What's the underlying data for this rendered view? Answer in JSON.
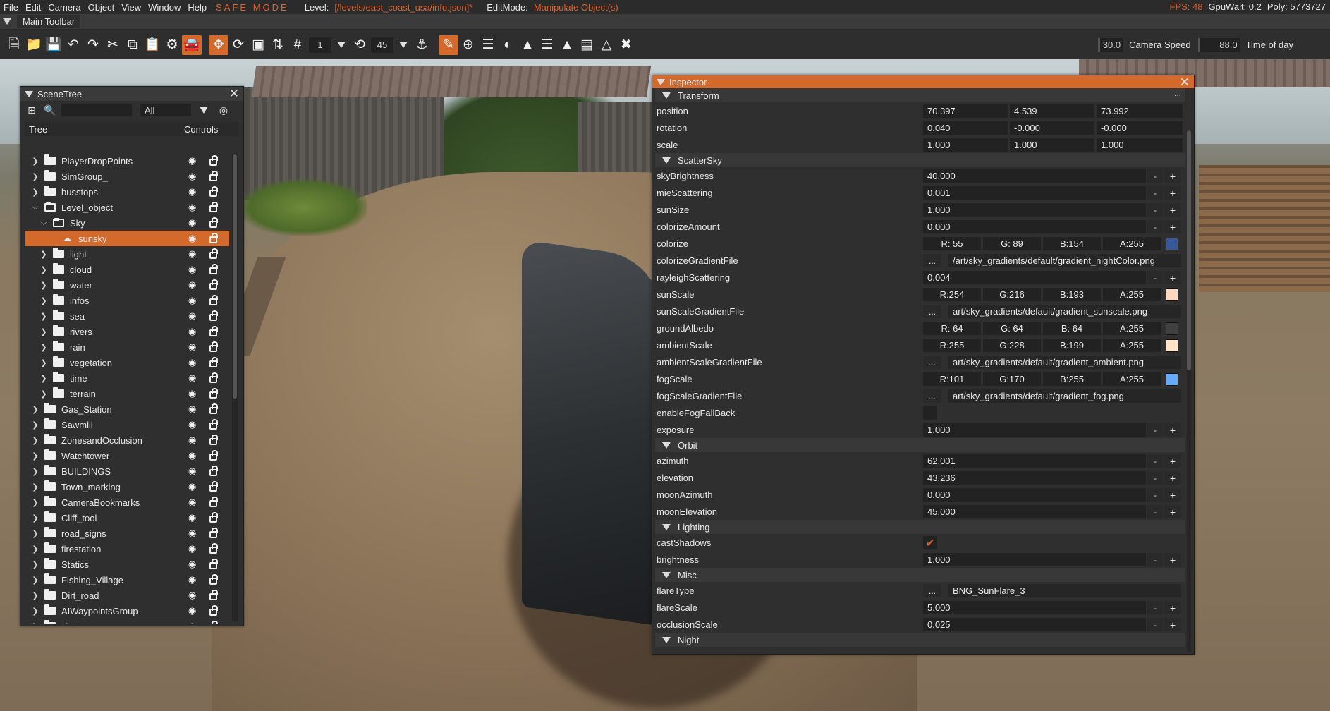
{
  "menubar": {
    "items": [
      "File",
      "Edit",
      "Camera",
      "Object",
      "View",
      "Window",
      "Help"
    ],
    "safe_mode": "SAFE MODE",
    "level_label": "Level:",
    "level_path": "[/levels/east_coast_usa/info.json]*",
    "editmode_label": "EditMode:",
    "editmode_value": "Manipulate Object(s)",
    "fps": "FPS: 48",
    "gpuwait": "GpuWait: 0.2",
    "poly": "Poly: 5773727"
  },
  "toolbar": {
    "title": "Main Toolbar",
    "grid_value": "1",
    "rotate_snap_value": "45",
    "camera_speed_value": "30.0",
    "camera_speed_label": "Camera Speed",
    "time_value": "88.0",
    "time_label": "Time of day"
  },
  "scenetree": {
    "title": "SceneTree",
    "filter": "All",
    "col_tree": "Tree",
    "col_controls": "Controls",
    "rows": [
      {
        "label": "PlayerDropPoints",
        "level": 0,
        "state": "collapsed"
      },
      {
        "label": "SimGroup_",
        "level": 0,
        "state": "collapsed"
      },
      {
        "label": "busstops",
        "level": 0,
        "state": "collapsed"
      },
      {
        "label": "Level_object",
        "level": 0,
        "state": "expanded"
      },
      {
        "label": "Sky",
        "level": 1,
        "state": "expanded"
      },
      {
        "label": "sunsky",
        "level": 2,
        "state": "object",
        "selected": true
      },
      {
        "label": "light",
        "level": 1,
        "state": "collapsed"
      },
      {
        "label": "cloud",
        "level": 1,
        "state": "collapsed"
      },
      {
        "label": "water",
        "level": 1,
        "state": "collapsed"
      },
      {
        "label": "infos",
        "level": 1,
        "state": "collapsed"
      },
      {
        "label": "sea",
        "level": 1,
        "state": "collapsed"
      },
      {
        "label": "rivers",
        "level": 1,
        "state": "collapsed"
      },
      {
        "label": "rain",
        "level": 1,
        "state": "collapsed"
      },
      {
        "label": "vegetation",
        "level": 1,
        "state": "collapsed"
      },
      {
        "label": "time",
        "level": 1,
        "state": "collapsed"
      },
      {
        "label": "terrain",
        "level": 1,
        "state": "collapsed"
      },
      {
        "label": "Gas_Station",
        "level": 0,
        "state": "collapsed"
      },
      {
        "label": "Sawmill",
        "level": 0,
        "state": "collapsed"
      },
      {
        "label": "ZonesandOcclusion",
        "level": 0,
        "state": "collapsed"
      },
      {
        "label": "Watchtower",
        "level": 0,
        "state": "collapsed"
      },
      {
        "label": "BUILDINGS",
        "level": 0,
        "state": "collapsed"
      },
      {
        "label": "Town_marking",
        "level": 0,
        "state": "collapsed"
      },
      {
        "label": "CameraBookmarks",
        "level": 0,
        "state": "collapsed"
      },
      {
        "label": "Cliff_tool",
        "level": 0,
        "state": "collapsed"
      },
      {
        "label": "road_signs",
        "level": 0,
        "state": "collapsed"
      },
      {
        "label": "firestation",
        "level": 0,
        "state": "collapsed"
      },
      {
        "label": "Statics",
        "level": 0,
        "state": "collapsed"
      },
      {
        "label": "Fishing_Village",
        "level": 0,
        "state": "collapsed"
      },
      {
        "label": "Dirt_road",
        "level": 0,
        "state": "collapsed"
      },
      {
        "label": "AIWaypointsGroup",
        "level": 0,
        "state": "collapsed"
      },
      {
        "label": "clutter",
        "level": 0,
        "state": "collapsed"
      }
    ]
  },
  "inspector": {
    "title": "Inspector",
    "sections": [
      {
        "name": "Transform",
        "more": "...",
        "props": [
          {
            "name": "position",
            "type": "vec3",
            "values": [
              "70.397",
              "4.539",
              "73.992"
            ]
          },
          {
            "name": "rotation",
            "type": "vec3",
            "values": [
              "0.040",
              "-0.000",
              "-0.000"
            ]
          },
          {
            "name": "scale",
            "type": "vec3",
            "values": [
              "1.000",
              "1.000",
              "1.000"
            ]
          }
        ]
      },
      {
        "name": "ScatterSky",
        "props": [
          {
            "name": "skyBrightness",
            "type": "num",
            "value": "40.000"
          },
          {
            "name": "mieScattering",
            "type": "num",
            "value": "0.001"
          },
          {
            "name": "sunSize",
            "type": "num",
            "value": "1.000"
          },
          {
            "name": "colorizeAmount",
            "type": "num",
            "value": "0.000"
          },
          {
            "name": "colorize",
            "type": "color",
            "r": "R: 55",
            "g": "G: 89",
            "b": "B:154",
            "a": "A:255",
            "swatch": "#37599a"
          },
          {
            "name": "colorizeGradientFile",
            "type": "file",
            "value": "/art/sky_gradients/default/gradient_nightColor.png"
          },
          {
            "name": "rayleighScattering",
            "type": "num",
            "value": "0.004"
          },
          {
            "name": "sunScale",
            "type": "color",
            "r": "R:254",
            "g": "G:216",
            "b": "B:193",
            "a": "A:255",
            "swatch": "#fed8c1"
          },
          {
            "name": "sunScaleGradientFile",
            "type": "file",
            "value": "art/sky_gradients/default/gradient_sunscale.png"
          },
          {
            "name": "groundAlbedo",
            "type": "color",
            "r": "R: 64",
            "g": "G: 64",
            "b": "B: 64",
            "a": "A:255",
            "swatch": "#404040"
          },
          {
            "name": "ambientScale",
            "type": "color",
            "r": "R:255",
            "g": "G:228",
            "b": "B:199",
            "a": "A:255",
            "swatch": "#ffe4c7"
          },
          {
            "name": "ambientScaleGradientFile",
            "type": "file",
            "value": "art/sky_gradients/default/gradient_ambient.png"
          },
          {
            "name": "fogScale",
            "type": "color",
            "r": "R:101",
            "g": "G:170",
            "b": "B:255",
            "a": "A:255",
            "swatch": "#65aaff"
          },
          {
            "name": "fogScaleGradientFile",
            "type": "file",
            "value": "art/sky_gradients/default/gradient_fog.png"
          },
          {
            "name": "enableFogFallBack",
            "type": "bool",
            "checked": false
          },
          {
            "name": "exposure",
            "type": "num",
            "value": "1.000"
          }
        ]
      },
      {
        "name": "Orbit",
        "props": [
          {
            "name": "azimuth",
            "type": "num",
            "value": "62.001"
          },
          {
            "name": "elevation",
            "type": "num",
            "value": "43.236"
          },
          {
            "name": "moonAzimuth",
            "type": "num",
            "value": "0.000"
          },
          {
            "name": "moonElevation",
            "type": "num",
            "value": "45.000"
          }
        ]
      },
      {
        "name": "Lighting",
        "props": [
          {
            "name": "castShadows",
            "type": "bool",
            "checked": true
          },
          {
            "name": "brightness",
            "type": "num",
            "value": "1.000"
          }
        ]
      },
      {
        "name": "Misc",
        "props": [
          {
            "name": "flareType",
            "type": "file",
            "value": "BNG_SunFlare_3"
          },
          {
            "name": "flareScale",
            "type": "num",
            "value": "5.000"
          },
          {
            "name": "occlusionScale",
            "type": "num",
            "value": "0.025"
          }
        ]
      },
      {
        "name": "Night",
        "props": []
      }
    ]
  }
}
